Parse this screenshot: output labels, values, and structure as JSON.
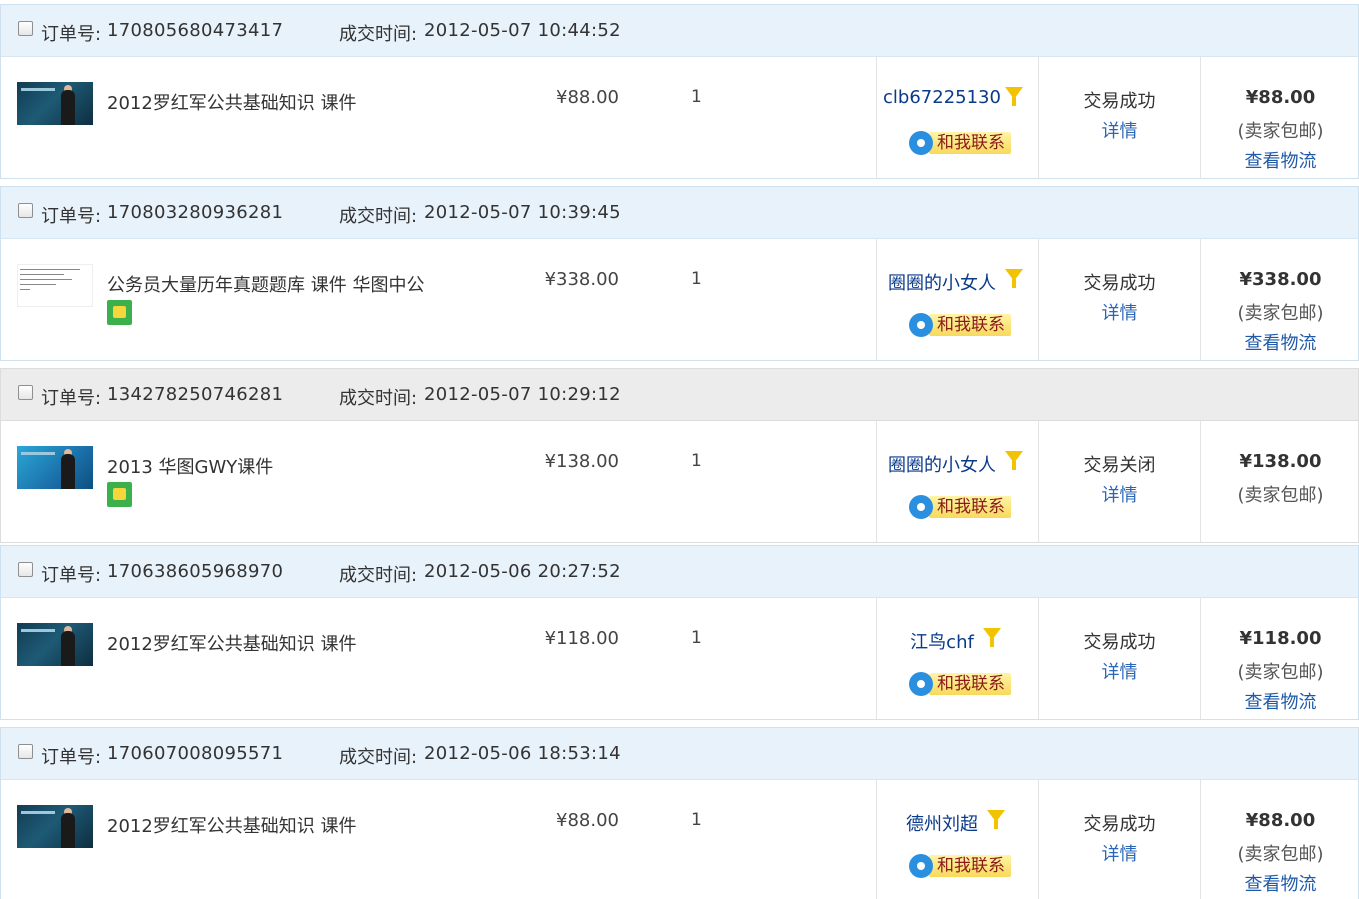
{
  "labels": {
    "order_no": "订单号:",
    "deal_time": "成交时间:",
    "contact": "和我联系",
    "detail": "详情",
    "shipping": "(卖家包邮)",
    "logistics": "查看物流"
  },
  "orders": [
    {
      "order_no": "170805680473417",
      "deal_time": "2012-05-07 10:44:52",
      "title": "2012罗红军公共基础知识 课件",
      "price": "¥88.00",
      "qty": "1",
      "seller": "clb67225130",
      "status": "交易成功",
      "total": "¥88.00"
    },
    {
      "order_no": "170803280936281",
      "deal_time": "2012-05-07 10:39:45",
      "title": "公务员大量历年真题题库 课件 华图中公",
      "price": "¥338.00",
      "qty": "1",
      "seller": "圈圈的小女人",
      "status": "交易成功",
      "total": "¥338.00"
    },
    {
      "order_no": "134278250746281",
      "deal_time": "2012-05-07 10:29:12",
      "title": "2013 华图GWY课件",
      "price": "¥138.00",
      "qty": "1",
      "seller": "圈圈的小女人",
      "status": "交易关闭",
      "total": "¥138.00"
    },
    {
      "order_no": "170638605968970",
      "deal_time": "2012-05-06 20:27:52",
      "title": "2012罗红军公共基础知识 课件",
      "price": "¥118.00",
      "qty": "1",
      "seller": "江鸟chf",
      "status": "交易成功",
      "total": "¥118.00"
    },
    {
      "order_no": "170607008095571",
      "deal_time": "2012-05-06 18:53:14",
      "title": "2012罗红军公共基础知识 课件",
      "price": "¥88.00",
      "qty": "1",
      "seller": "德州刘超",
      "status": "交易成功",
      "total": "¥88.00"
    }
  ]
}
